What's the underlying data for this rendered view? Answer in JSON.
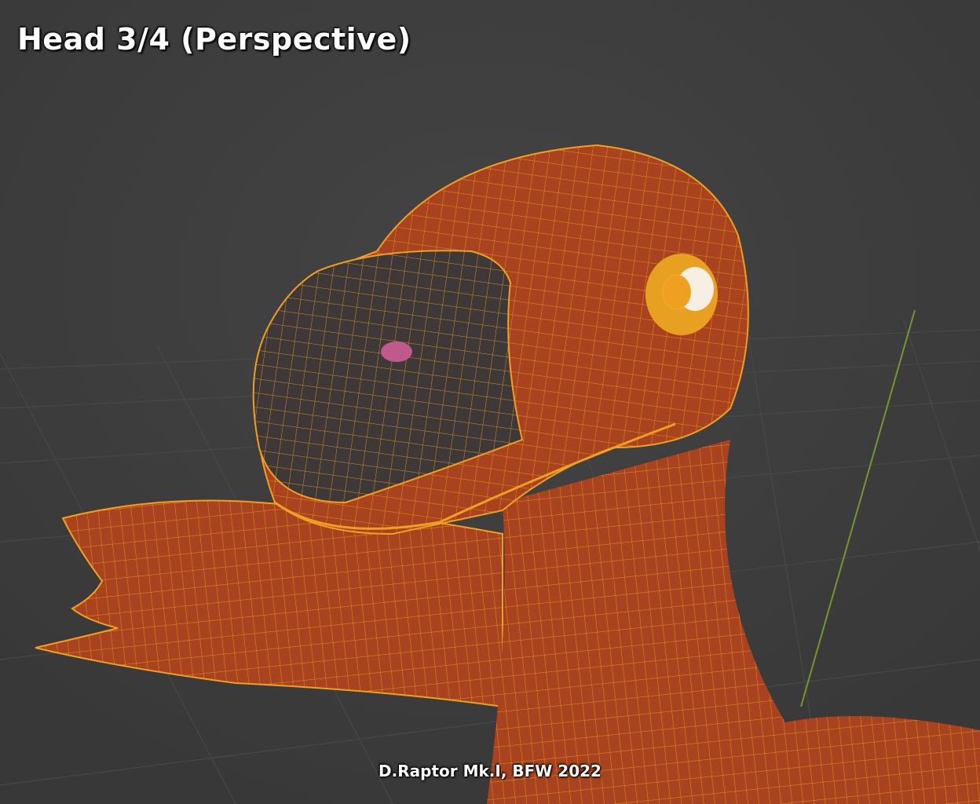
{
  "viewport": {
    "title": "Head 3/4 (Perspective)",
    "caption": "D.Raptor Mk.I, BFW 2022"
  },
  "colors": {
    "background": "#3d3d3d",
    "grid": "#4a4a4a",
    "y_axis": "#6f9a2c",
    "skin": "#a8421f",
    "beak": "#3e3838",
    "wireframe": "#f0a020",
    "eye": "#e8a020"
  }
}
